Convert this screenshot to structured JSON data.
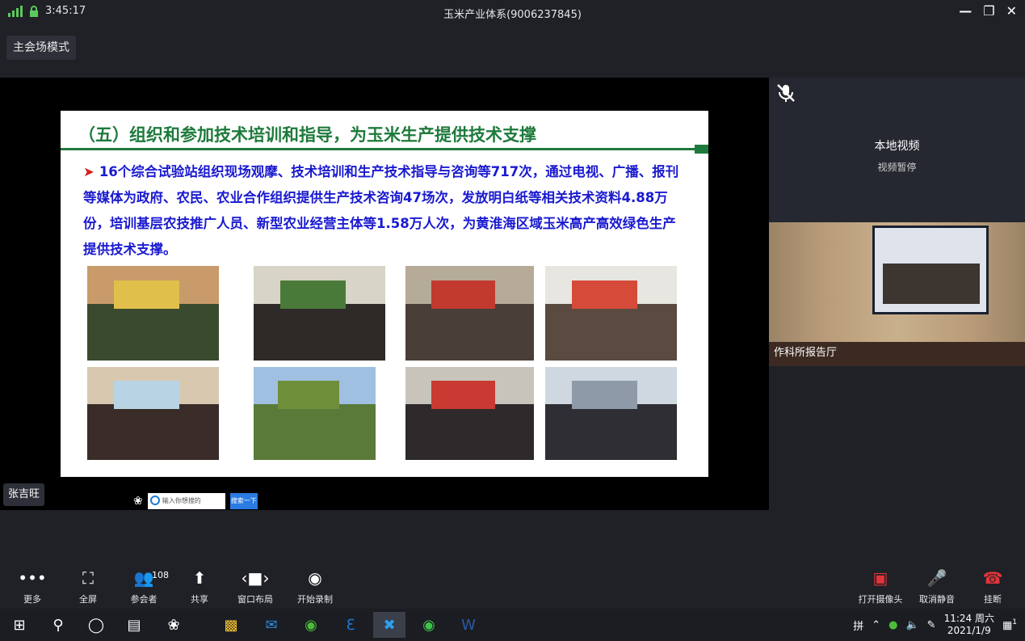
{
  "titlebar": {
    "time": "3:45:17",
    "title": "玉米产业体系(9006237845)",
    "minimize_icon": "minimize-icon",
    "restore_icon": "restore-icon",
    "close_icon": "close-icon"
  },
  "mode_button": "主会场模式",
  "slide": {
    "title": "（五）组织和参加技术培训和指导，为玉米生产提供技术支撑",
    "body": "16个综合试验站组织现场观摩、技术培训和生产技术指导与咨询等717次，通过电视、广播、报刊等媒体为政府、农民、农业合作组织提供生产技术咨询47场次，发放明白纸等相关技术资料4.88万份，培训基层农技推广人员、新型农业经营主体等1.58万人次，为黄淮海区域玉米高产高效绿色生产提供技术支撑。",
    "photos": [
      {
        "a": "#c99a6a",
        "b": "#3a4a2e",
        "c": "#e0c04a"
      },
      {
        "a": "#d8d4c8",
        "b": "#2e2a28",
        "c": "#4a7a3a"
      },
      {
        "a": "#b6aa98",
        "b": "#4a3e38",
        "c": "#c23a2e"
      },
      {
        "a": "#e8e6e0",
        "b": "#5a4a40",
        "c": "#d64a3a"
      },
      {
        "a": "#d8c8b0",
        "b": "#3a2c28",
        "c": "#b8d4e4"
      },
      {
        "a": "#9fc0e0",
        "b": "#5a7a3a",
        "c": "#6e8e3a"
      },
      {
        "a": "#c8c4bc",
        "b": "#2e2a2c",
        "c": "#c83a32"
      },
      {
        "a": "#cfd8e0",
        "b": "#2e2e34",
        "c": "#8e9aa8"
      }
    ]
  },
  "speaker_name": "张吉旺",
  "search": {
    "placeholder": "输入你想搜的",
    "button": "搜索一下"
  },
  "local_video": {
    "title": "本地视频",
    "subtitle": "视频暂停",
    "mic_icon": "mic-muted-icon"
  },
  "remote_video": {
    "label": "作科所报告厅"
  },
  "toolbar": {
    "more": "更多",
    "fullscreen": "全屏",
    "participants": "参会者",
    "participants_count": "108",
    "share": "共享",
    "layout": "窗口布局",
    "record": "开始录制",
    "camera": "打开摄像头",
    "unmute": "取消静音",
    "hangup": "挂断"
  },
  "taskbar": {
    "ime": "拼",
    "time": "11:24 周六",
    "date": "2021/1/9",
    "notifications": "1"
  },
  "colors": {
    "slide_title": "#1e7a3c",
    "slide_body": "#1a1ad0",
    "bullet": "#d42020",
    "danger": "#e2343a"
  }
}
